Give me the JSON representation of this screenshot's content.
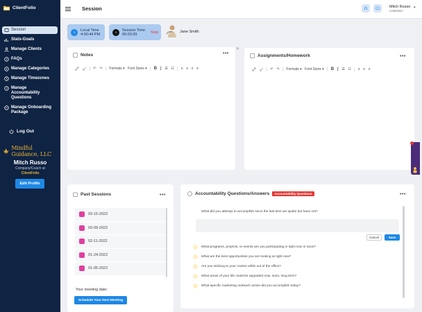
{
  "brand": {
    "logo_text": "ClientFolio"
  },
  "sidebar": {
    "items": [
      {
        "label": "Session"
      },
      {
        "label": "Stats-Goals"
      },
      {
        "label": "Manage Clients"
      },
      {
        "label": "FAQs"
      },
      {
        "label": "Manage Categories"
      },
      {
        "label": "Manage Timezones"
      },
      {
        "label": "Manage Accountability Questions"
      },
      {
        "label": "Manage Onboarding Package"
      }
    ],
    "logout": "Log Out",
    "org_name": "Mindful Guidance, LLC",
    "coach_name": "Mitch Russo",
    "coach_subtitle": "Company/Coach at",
    "coach_company": "ClientFolio",
    "edit_profile": "Edit Profile"
  },
  "header": {
    "title": "Session",
    "user_name": "Mitch Russo",
    "user_role": "COMPANY"
  },
  "timers": {
    "local_label": "Local Time",
    "local_value": "4:00:44 PM",
    "session_label": "Session Time",
    "session_value": "00:00:39",
    "stop_label": "Stop",
    "client_name": "Jane Smith"
  },
  "notes": {
    "title": "Notes"
  },
  "assignments": {
    "title": "Assignments/Homework"
  },
  "editor_toolbar": {
    "formats": "Formats",
    "font_sizes": "Font Sizes",
    "bold": "B",
    "italic": "I"
  },
  "past_sessions": {
    "title": "Past Sessions",
    "dates": [
      "03-15-2022",
      "03-09-2022",
      "02-11-2022",
      "01-24-2022",
      "01-05-2022"
    ],
    "meeting_label": "Your meeting date:",
    "schedule_button": "Schedule Your Next Meeting"
  },
  "accountability": {
    "title": "Accountability Questions/Answers",
    "badge": "Accountability Questions",
    "first_question": "What did you attempt to accomplish since the last time we spoke but have not?",
    "cancel": "Cancel",
    "save": "Save",
    "questions": [
      "What programs, projects, or events are you participating in right now or soon?",
      "What are the best opportunities you are looking at right now?",
      "Are you sticking to your routine while out of the office?",
      "What areas of your life could be upgraded now, soon, long term?",
      "What specific marketing outreach action did you accomplish today?"
    ]
  },
  "colors": {
    "sidebar_bg": "#0f2343",
    "accent": "#1e88e5",
    "danger": "#e53935",
    "gold": "#e8b332"
  }
}
